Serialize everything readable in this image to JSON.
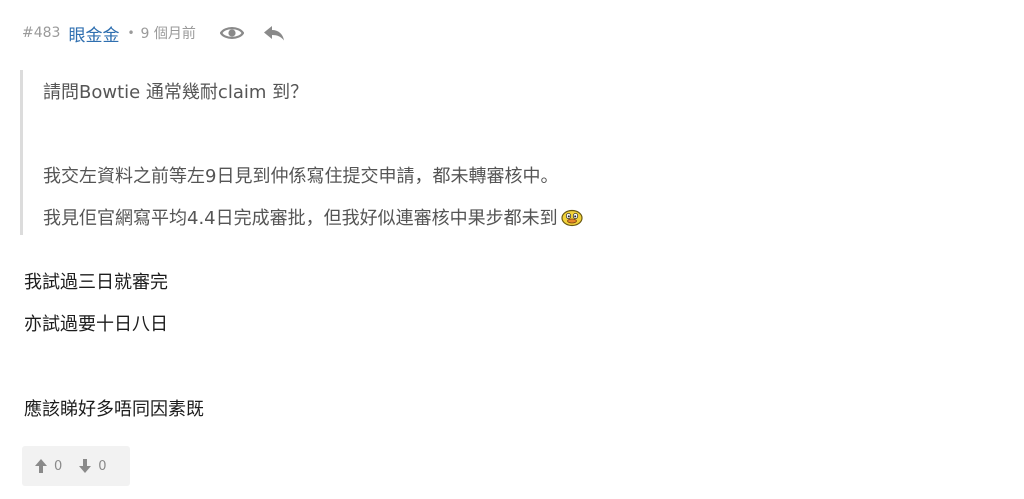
{
  "post": {
    "number": "#483",
    "username": "眼金金",
    "separator": "•",
    "time": "9 個月前"
  },
  "icons": {
    "view": "eye-icon",
    "reply": "reply-icon",
    "upvote": "arrow-up-icon",
    "downvote": "arrow-down-icon",
    "quote_emoji": "duck-emoji-icon"
  },
  "quote": {
    "line1": "請問Bowtie 通常幾耐claim 到？",
    "line2": "我交左資料之前等左9日見到仲係寫住提交申請，都未轉審核中。",
    "line3": "我見佢官網寫平均4.4日完成審批，但我好似連審核中果步都未到"
  },
  "reply": {
    "line1": "我試過三日就審完",
    "line2": "亦試過要十日八日",
    "line3": "應該睇好多唔同因素既"
  },
  "votes": {
    "up": "0",
    "down": "0"
  },
  "colors": {
    "username": "#2f6fb0",
    "meta_text": "#9a9a9a",
    "quote_border": "#dcdcdc",
    "vote_bg": "#f2f2f2"
  }
}
